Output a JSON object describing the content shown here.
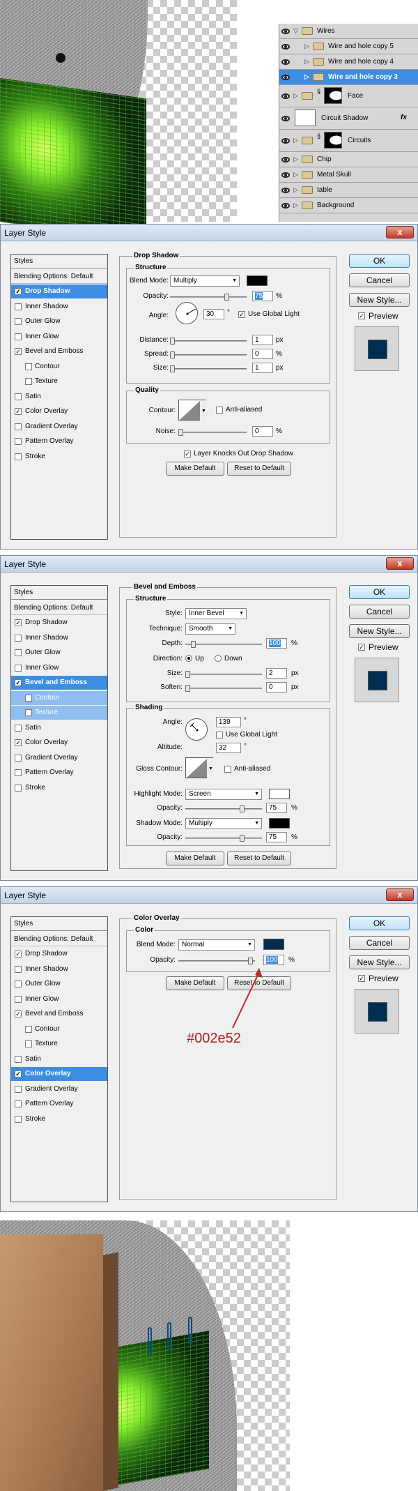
{
  "layers_panel": {
    "rows": [
      {
        "name": "Wires",
        "kind": "group",
        "expanded": true,
        "selected": false
      },
      {
        "name": "Wire and hole copy 5",
        "kind": "group",
        "expanded": false,
        "selected": false
      },
      {
        "name": "Wire and hole copy 4",
        "kind": "group",
        "expanded": false,
        "selected": false
      },
      {
        "name": "Wire and hole copy 3",
        "kind": "group",
        "expanded": false,
        "selected": true
      },
      {
        "name": "Face",
        "kind": "group-mask",
        "expanded": false,
        "selected": false
      },
      {
        "name": "Circuit Shadow",
        "kind": "layer-fx",
        "expanded": false,
        "selected": false
      },
      {
        "name": "Circuits",
        "kind": "group-mask",
        "expanded": false,
        "selected": false
      },
      {
        "name": "Chip",
        "kind": "group",
        "expanded": false,
        "selected": false
      },
      {
        "name": "Metal Skull",
        "kind": "group",
        "expanded": false,
        "selected": false
      },
      {
        "name": "table",
        "kind": "group",
        "expanded": false,
        "selected": false
      },
      {
        "name": "Background",
        "kind": "group",
        "expanded": false,
        "selected": false
      }
    ],
    "fx_label": "fx"
  },
  "styles_list": [
    {
      "label": "Styles",
      "type": "header"
    },
    {
      "label": "Blending Options: Default",
      "type": "blend"
    },
    {
      "label": "Drop Shadow",
      "type": "item"
    },
    {
      "label": "Inner Shadow",
      "type": "item"
    },
    {
      "label": "Outer Glow",
      "type": "item"
    },
    {
      "label": "Inner Glow",
      "type": "item"
    },
    {
      "label": "Bevel and Emboss",
      "type": "item"
    },
    {
      "label": "Contour",
      "type": "sub"
    },
    {
      "label": "Texture",
      "type": "sub"
    },
    {
      "label": "Satin",
      "type": "item"
    },
    {
      "label": "Color Overlay",
      "type": "item"
    },
    {
      "label": "Gradient Overlay",
      "type": "item"
    },
    {
      "label": "Pattern Overlay",
      "type": "item"
    },
    {
      "label": "Stroke",
      "type": "item"
    }
  ],
  "dialogs": [
    {
      "title": "Layer Style",
      "close": "x",
      "selected_style": "Drop Shadow",
      "checked": [
        "Drop Shadow",
        "Bevel and Emboss",
        "Color Overlay"
      ],
      "panel_title": "Drop Shadow",
      "structure_title": "Structure",
      "blend_mode_label": "Blend Mode:",
      "blend_mode": "Multiply",
      "blend_color": "#000000",
      "opacity_label": "Opacity:",
      "opacity": "75",
      "angle_label": "Angle:",
      "angle": "30",
      "use_global_light": "Use Global Light",
      "use_global_light_checked": true,
      "distance_label": "Distance:",
      "distance": "1",
      "spread_label": "Spread:",
      "spread": "0",
      "size_label": "Size:",
      "size": "1",
      "quality_title": "Quality",
      "contour_label": "Contour:",
      "anti_aliased": "Anti-aliased",
      "noise_label": "Noise:",
      "noise": "0",
      "knocks_out": "Layer Knocks Out Drop Shadow",
      "make_default": "Make Default",
      "reset_default": "Reset to Default"
    },
    {
      "title": "Layer Style",
      "close": "x",
      "selected_style": "Bevel and Emboss",
      "checked": [
        "Drop Shadow",
        "Bevel and Emboss",
        "Color Overlay"
      ],
      "panel_title": "Bevel and Emboss",
      "structure_title": "Structure",
      "style_label": "Style:",
      "style": "Inner Bevel",
      "technique_label": "Technique:",
      "technique": "Smooth",
      "depth_label": "Depth:",
      "depth": "100",
      "direction_label": "Direction:",
      "dir_up": "Up",
      "dir_down": "Down",
      "size_label": "Size:",
      "size": "2",
      "soften_label": "Soften:",
      "soften": "0",
      "shading_title": "Shading",
      "angle_label": "Angle:",
      "angle": "139",
      "use_global_light": "Use Global Light",
      "altitude_label": "Altitude:",
      "altitude": "32",
      "gloss_label": "Gloss Contour:",
      "anti_aliased": "Anti-aliased",
      "highlight_mode_label": "Highlight Mode:",
      "highlight_mode": "Screen",
      "highlight_color": "#ffffff",
      "hl_opacity_label": "Opacity:",
      "hl_opacity": "75",
      "shadow_mode_label": "Shadow Mode:",
      "shadow_mode": "Multiply",
      "shadow_color": "#000000",
      "sh_opacity_label": "Opacity:",
      "sh_opacity": "75",
      "make_default": "Make Default",
      "reset_default": "Reset to Default"
    },
    {
      "title": "Layer Style",
      "close": "x",
      "selected_style": "Color Overlay",
      "checked": [
        "Drop Shadow",
        "Bevel and Emboss",
        "Color Overlay"
      ],
      "panel_title": "Color Overlay",
      "color_title": "Color",
      "blend_mode_label": "Blend Mode:",
      "blend_mode": "Normal",
      "blend_color": "#002e52",
      "opacity_label": "Opacity:",
      "opacity": "100",
      "make_default": "Make Default",
      "reset_default": "Reset to Default"
    }
  ],
  "side_buttons": {
    "ok": "OK",
    "cancel": "Cancel",
    "new_style": "New Style...",
    "preview": "Preview"
  },
  "preview_color": "#002e52",
  "annotation": {
    "text": "#002e52",
    "color": "#b81c1c"
  },
  "units": {
    "percent": "%",
    "px": "px",
    "degree": "°"
  }
}
